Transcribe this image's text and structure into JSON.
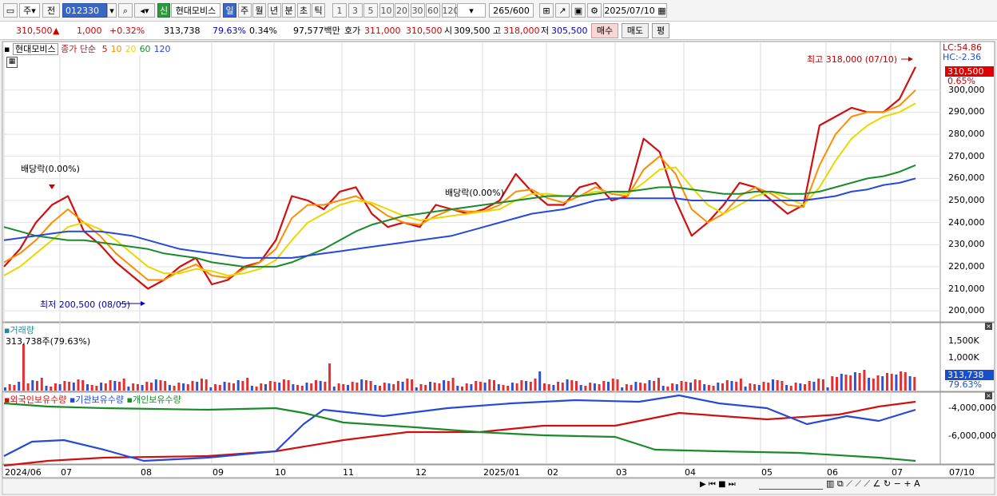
{
  "toolbar": {
    "type_select": "주",
    "mode": "전",
    "code": "012330",
    "badge": "신",
    "stock_name": "현대모비스",
    "periods": [
      "일",
      "주",
      "월",
      "년",
      "분",
      "초",
      "틱"
    ],
    "active_period": "일",
    "intervals": [
      "1",
      "3",
      "5",
      "10",
      "20",
      "30",
      "60",
      "120"
    ],
    "count_current": "265",
    "count_total": "/600",
    "date": "2025/07/10"
  },
  "quote": {
    "price": "310,500",
    "arrow": "▲",
    "change": "1,000",
    "change_pct": "+0.32%",
    "volume": "313,738",
    "volume_ratio": "79.63%",
    "turnover_pct": "0.34%",
    "amount": "97,577백만",
    "ask_label": "호가",
    "ask": "311,000",
    "bid": "310,500",
    "open_label": "시",
    "open": "309,500",
    "high_label": "고",
    "high": "318,000",
    "low_label": "저",
    "low": "305,500",
    "buy_button": "매수",
    "sell_button": "매도",
    "eval_button": "평"
  },
  "legend": {
    "stock": "현대모비스",
    "label": "종가 단순",
    "ma": [
      {
        "period": "5",
        "color": "#d01010"
      },
      {
        "period": "10",
        "color": "#ff8c00"
      },
      {
        "period": "20",
        "color": "#e8d800"
      },
      {
        "period": "60",
        "color": "#1a8a2a"
      },
      {
        "period": "120",
        "color": "#2848d8"
      }
    ]
  },
  "annotations": {
    "high": "최고 318,000 (07/10)",
    "low": "최저 200,500 (08/05)",
    "dividend1": "배당락(0.00%)",
    "dividend2": "배당락(0.00%)",
    "lc": "LC:54.86",
    "hc": "HC:-2.36",
    "last_price": "310,500",
    "last_pct": "0.65%"
  },
  "volume_panel": {
    "title": "거래량",
    "value": "313,738주(79.63%)",
    "last": "313,738",
    "last_pct": "79.63%",
    "ticks": [
      "1,500K",
      "1,000K"
    ]
  },
  "holdings_panel": {
    "series": [
      "외국인보유수량",
      "기관보유수량",
      "개인보유수량"
    ],
    "colors": [
      "#d01010",
      "#2848d8",
      "#1a8a2a"
    ],
    "ticks": [
      "-4,000,000",
      "-6,000,000"
    ]
  },
  "x_axis": [
    "2024/06",
    "07",
    "08",
    "09",
    "10",
    "11",
    "12",
    "2025/01",
    "02",
    "03",
    "04",
    "05",
    "06",
    "07"
  ],
  "x_axis_end": "07/10",
  "chart_data": {
    "type": "line",
    "ylim": [
      195000,
      322000
    ],
    "yticks": [
      "300,000",
      "290,000",
      "280,000",
      "270,000",
      "260,000",
      "250,000",
      "240,000",
      "230,000",
      "220,000",
      "210,000",
      "200,000"
    ],
    "series": [
      {
        "values": [
          220000,
          228000,
          240000,
          248000,
          252000,
          236000,
          230000,
          222000,
          216000,
          210000,
          214000,
          220000,
          224000,
          212000,
          214000,
          220000,
          222000,
          232000,
          252000,
          250000,
          246000,
          254000,
          256000,
          244000,
          238000,
          240000,
          238000,
          248000,
          246000,
          244000,
          246000,
          250000,
          262000,
          254000,
          248000,
          248000,
          256000,
          258000,
          250000,
          252000,
          278000,
          272000,
          250000,
          234000,
          240000,
          248000,
          258000,
          256000,
          250000,
          244000,
          248000,
          284000,
          288000,
          292000,
          290000,
          290000,
          296000,
          310500
        ]
      },
      {
        "values": [
          222000,
          226000,
          232000,
          240000,
          246000,
          240000,
          234000,
          226000,
          220000,
          214000,
          214000,
          218000,
          221000,
          216000,
          215000,
          219000,
          222000,
          228000,
          242000,
          248000,
          248000,
          250000,
          252000,
          248000,
          243000,
          240000,
          239000,
          243000,
          246000,
          245000,
          245000,
          248000,
          254000,
          255000,
          251000,
          249000,
          252000,
          256000,
          253000,
          252000,
          264000,
          270000,
          262000,
          246000,
          240000,
          244000,
          252000,
          256000,
          253000,
          248000,
          247000,
          266000,
          280000,
          288000,
          290000,
          290000,
          293000,
          300000
        ]
      },
      {
        "values": [
          216000,
          220000,
          226000,
          232000,
          238000,
          240000,
          237000,
          232000,
          226000,
          220000,
          217000,
          217000,
          219000,
          218000,
          216000,
          217000,
          219000,
          223000,
          232000,
          240000,
          244000,
          248000,
          250000,
          249000,
          246000,
          243000,
          241000,
          242000,
          243000,
          244000,
          245000,
          246000,
          250000,
          253000,
          253000,
          252000,
          252000,
          254000,
          254000,
          253000,
          258000,
          264000,
          265000,
          256000,
          248000,
          244000,
          248000,
          252000,
          254000,
          251000,
          248000,
          256000,
          268000,
          278000,
          284000,
          288000,
          290000,
          294000
        ]
      },
      {
        "values": [
          238000,
          236000,
          234000,
          233000,
          232000,
          232000,
          231000,
          230000,
          229000,
          228000,
          226000,
          225000,
          224000,
          222000,
          221000,
          220000,
          220000,
          220000,
          222000,
          225000,
          228000,
          232000,
          236000,
          239000,
          241000,
          243000,
          244000,
          245000,
          246000,
          247000,
          248000,
          249000,
          250000,
          251000,
          252000,
          252000,
          252000,
          253000,
          254000,
          254000,
          255000,
          256000,
          256000,
          255000,
          254000,
          253000,
          253000,
          254000,
          254000,
          253000,
          253000,
          254000,
          256000,
          258000,
          260000,
          261000,
          263000,
          266000
        ]
      },
      {
        "values": [
          232000,
          233000,
          234000,
          235000,
          236000,
          236000,
          236000,
          235000,
          234000,
          232000,
          230000,
          228000,
          227000,
          226000,
          225000,
          224000,
          224000,
          224000,
          224000,
          225000,
          226000,
          227000,
          228000,
          229000,
          230000,
          231000,
          232000,
          233000,
          234000,
          236000,
          238000,
          240000,
          242000,
          244000,
          245000,
          246000,
          248000,
          250000,
          251000,
          251000,
          251000,
          251000,
          251000,
          250000,
          250000,
          250000,
          250000,
          250000,
          250000,
          250000,
          250000,
          251000,
          252000,
          254000,
          255000,
          257000,
          258000,
          260000
        ]
      }
    ]
  }
}
